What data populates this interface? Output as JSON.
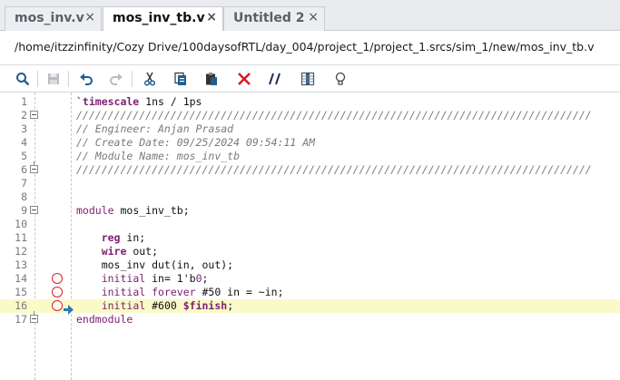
{
  "tabs": [
    {
      "label": "mos_inv.v",
      "close": "×",
      "active": false
    },
    {
      "label": "mos_inv_tb.v",
      "close": "×",
      "active": true
    },
    {
      "label": "Untitled 2",
      "close": "×",
      "active": false
    }
  ],
  "path": "/home/itzzinfinity/Cozy Drive/100daysofRTL/day_004/project_1/project_1.srcs/sim_1/new/mos_inv_tb.v",
  "toolbar": {
    "icons": [
      "search-icon",
      "save-icon",
      "undo-icon",
      "redo-icon",
      "cut-icon",
      "copy-icon",
      "paste-icon",
      "delete-icon",
      "comment-icon",
      "column-select-icon",
      "lightbulb-icon"
    ]
  },
  "colors": {
    "keyword": "#7b1f6e",
    "comment": "#7a7a7a",
    "highlight": "#fafac8",
    "breakpoint": "#dd2222",
    "arrow": "#2a7ab8",
    "delete": "#d81e1e"
  },
  "editor": {
    "line_numbers": [
      "1",
      "2",
      "3",
      "4",
      "5",
      "6",
      "7",
      "8",
      "9",
      "10",
      "11",
      "12",
      "13",
      "14",
      "15",
      "16",
      "17"
    ],
    "current_line": "16",
    "breakpoint_lines": [
      "14",
      "15",
      "16"
    ],
    "lines": {
      "l1": {
        "directive": "`timescale",
        "rest": " 1ns / 1ps"
      },
      "l2": "//////////////////////////////////////////////////////////////////////////////////",
      "l3": "// Engineer: Anjan Prasad",
      "l4": "// Create Date: 09/25/2024 09:54:11 AM",
      "l5": "// Module Name: mos_inv_tb",
      "l6": "//////////////////////////////////////////////////////////////////////////////////",
      "l9": {
        "kw": "module",
        "rest": " mos_inv_tb;"
      },
      "l11": {
        "indent": "    ",
        "kw": "reg",
        "rest": " in;"
      },
      "l12": {
        "indent": "    ",
        "kw": "wire",
        "rest": " out;"
      },
      "l13": "    mos_inv dut(in, out);",
      "l14": {
        "indent": "    ",
        "kw": "initial",
        "mid": " in= 1'b",
        "num": "0",
        "end": ";"
      },
      "l15": {
        "indent": "    ",
        "kw": "initial forever",
        "mid": " #50 in = ~in;"
      },
      "l16": {
        "indent": "    ",
        "kw": "initial",
        "mid": " #600 ",
        "sys": "$finish",
        "end": ";"
      },
      "l17": {
        "kw": "endmodule"
      }
    }
  }
}
